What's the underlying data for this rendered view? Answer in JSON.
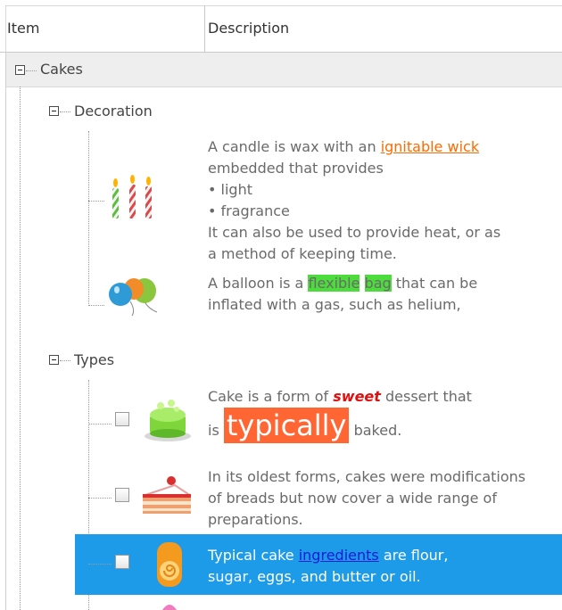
{
  "columns": {
    "item": "Item",
    "description": "Description"
  },
  "groups": [
    {
      "label": "Cakes"
    }
  ],
  "subgroups": {
    "decoration": "Decoration",
    "types": "Types"
  },
  "decoration_rows": {
    "candle": {
      "line1_pre": "A candle is wax with an ",
      "line1_link": "ignitable wick",
      "line2": "embedded that provides",
      "bullet1": "• light",
      "bullet2": "• fragrance",
      "line5": "It can also be used to provide heat, or as",
      "line6": "a method of keeping time."
    },
    "balloon": {
      "pre": "A balloon is a ",
      "hl1": "flexible",
      "hl2": "bag",
      "post": " that can be",
      "line2": "inflated with a gas, such as helium,"
    }
  },
  "types_rows": {
    "cake1": {
      "pre": "Cake is a form of ",
      "sweet": "sweet",
      "post": " dessert that",
      "is": "is ",
      "typically": "typically",
      "baked": " baked."
    },
    "cake2": {
      "line1": "In its oldest forms, cakes were modifications",
      "line2": "of breads but now cover a wide range of",
      "line3": "preparations."
    },
    "cake3": {
      "pre": "Typical cake ",
      "link": "ingredients",
      "post": " are flour,",
      "line2": "sugar, eggs, and butter or oil."
    }
  },
  "colors": {
    "selection": "#1e9be8",
    "link_orange": "#ff6a00",
    "highlight_green": "#4cdc3c",
    "emphasis_red": "#e01010",
    "typically_bg": "#ff6633"
  },
  "icons": [
    "candles-icon",
    "balloons-icon",
    "green-cake-icon",
    "cake-slice-icon",
    "cake-roll-icon",
    "pink-cake-icon"
  ]
}
